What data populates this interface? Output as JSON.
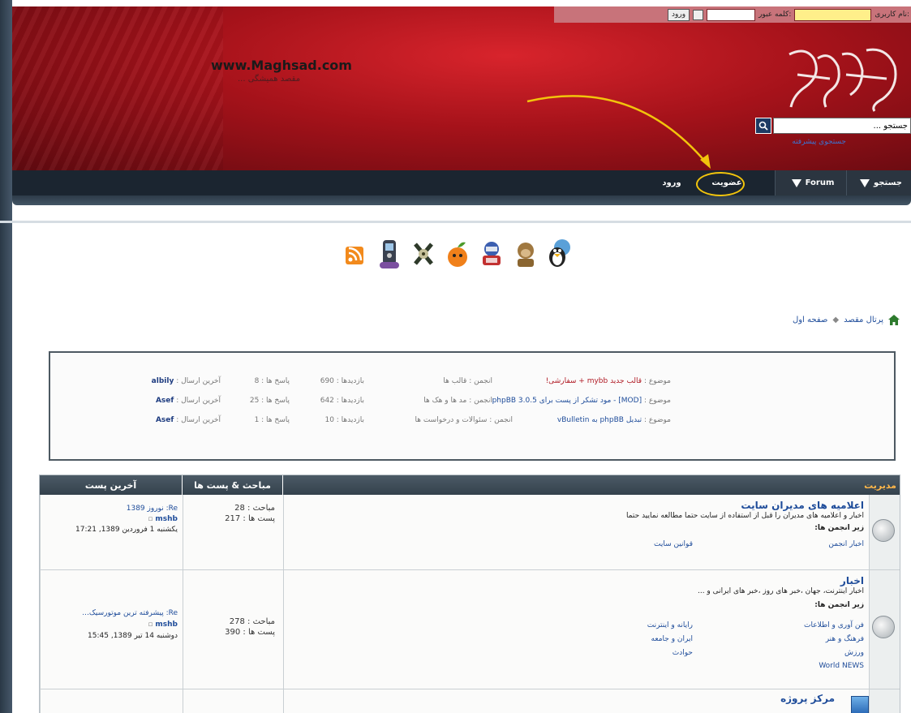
{
  "header": {
    "site_url": "www.Maghsad.com",
    "slogan": "مقصد همیشگی ...",
    "login": {
      "username_label": "نام کاربری:",
      "password_label": "کلمه عبور:",
      "login_button": "ورود"
    },
    "search": {
      "placeholder": "جستجو ...",
      "advanced_label": "جستجوی پیشرفته"
    }
  },
  "nav": {
    "items": [
      {
        "label": "جستجو"
      },
      {
        "label": "Forum"
      },
      {
        "label": "عضویت"
      },
      {
        "label": "ورود"
      }
    ]
  },
  "icons_row": [
    "linux-tux-icon",
    "globe-icon",
    "monkey-icon",
    "robot-icon",
    "fruit-icon",
    "film-reel-icon",
    "phone-icon",
    "rss-icon"
  ],
  "breadcrumb": {
    "portal": "پرتال مقصد",
    "home": "صفحه اول"
  },
  "latest_topics": [
    {
      "topic_prefix": "موضوع :",
      "topic": "قالب جدید mybb + سفارشی!",
      "forum_prefix": "انجمن :",
      "forum": "قالب ها",
      "views": "بازدیدها : 690",
      "replies": "پاسخ ها : 8",
      "last_label": "آخرین ارسال :",
      "last_user": "albily"
    },
    {
      "topic_prefix": "موضوع :",
      "topic": "[MOD] - مود تشکر از پست برای phpBB 3.0.5",
      "forum_prefix": "انجمن :",
      "forum": "مد ها و هک ها",
      "views": "بازدیدها : 642",
      "replies": "پاسخ ها : 25",
      "last_label": "آخرین ارسال :",
      "last_user": "Asef"
    },
    {
      "topic_prefix": "موضوع :",
      "topic": "تبدیل phpBB به vBulletin",
      "forum_prefix": "انجمن :",
      "forum": "سئوالات و درخواست ها",
      "views": "بازدیدها : 10",
      "replies": "پاسخ ها : 1",
      "last_label": "آخرین ارسال :",
      "last_user": "Asef"
    }
  ],
  "forum_table": {
    "category": "مدیریت",
    "col_topics": "مباحث & پست ها",
    "col_last": "آخرین پست",
    "rows": [
      {
        "title": "اعلامیه های مدیران سایت",
        "desc": "اخبار و اعلامیه های مدیران را قبل از استفاده از سایت حتما مطالعه نمایید حتما",
        "subs_label": "زیر انجمن ها:",
        "subs": [
          "اخبار انجمن",
          "قوانین سایت"
        ],
        "topics": "مباحث : 28",
        "posts": "پست ها : 217",
        "last_title": "Re: نوروز 1389",
        "last_user": "mshb",
        "last_date": "یکشنبه 1 فروردین 1389, 17:21"
      },
      {
        "title": "اخبار",
        "desc": "اخبار اینترنت، جهان ،خبر های روز ،خبر های ایرانی و ...",
        "subs_label": "زیر انجمن ها:",
        "subs": [
          "فن آوری و اطلاعات",
          "رایانه و اینترنت",
          "فرهنگ و هنر",
          "ایران و جامعه",
          "ورزش",
          "حوادث",
          "World NEWS"
        ],
        "topics": "مباحث : 278",
        "posts": "پست ها : 390",
        "last_title": "Re: پیشرفته ترین موتورسیک...",
        "last_user": "mshb",
        "last_date": "دوشنبه 14 تیر 1389, 15:45"
      },
      {
        "title": "مرکز پروژه",
        "desc": "",
        "subs_label": "",
        "subs": [],
        "topics": "",
        "posts": "",
        "last_title": "",
        "last_user": "",
        "last_date": ""
      }
    ]
  },
  "colors": {
    "header_red": "#b3141c",
    "nav_dark": "#1b2530",
    "link_blue": "#1e4c9a",
    "highlight_yellow": "#f2c40c",
    "category_orange": "#ffb74a"
  }
}
